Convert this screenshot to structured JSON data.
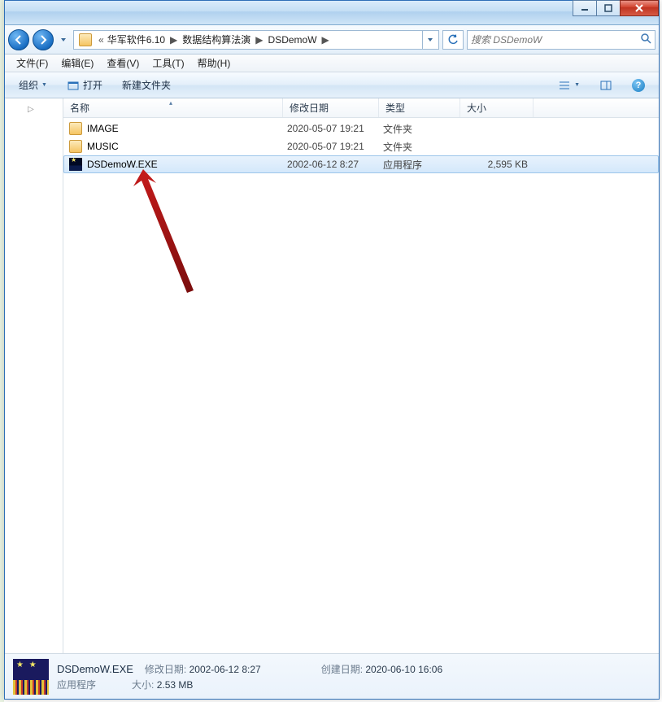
{
  "breadcrumb": {
    "lead": "«",
    "items": [
      "华军软件6.10",
      "数据结构算法演",
      "DSDemoW"
    ]
  },
  "search": {
    "placeholder": "搜索 DSDemoW"
  },
  "menubar": [
    "文件(F)",
    "编辑(E)",
    "查看(V)",
    "工具(T)",
    "帮助(H)"
  ],
  "toolbar": {
    "organize": "组织",
    "open": "打开",
    "newfolder": "新建文件夹"
  },
  "columns": {
    "name": "名称",
    "date": "修改日期",
    "type": "类型",
    "size": "大小"
  },
  "files": [
    {
      "name": "IMAGE",
      "date": "2020-05-07 19:21",
      "type": "文件夹",
      "size": "",
      "kind": "folder",
      "selected": false
    },
    {
      "name": "MUSIC",
      "date": "2020-05-07 19:21",
      "type": "文件夹",
      "size": "",
      "kind": "folder",
      "selected": false
    },
    {
      "name": "DSDemoW.EXE",
      "date": "2002-06-12 8:27",
      "type": "应用程序",
      "size": "2,595 KB",
      "kind": "exe",
      "selected": true
    }
  ],
  "details": {
    "name": "DSDemoW.EXE",
    "type": "应用程序",
    "mod_label": "修改日期:",
    "mod_value": "2002-06-12 8:27",
    "create_label": "创建日期:",
    "create_value": "2020-06-10 16:06",
    "size_label": "大小:",
    "size_value": "2.53 MB"
  }
}
